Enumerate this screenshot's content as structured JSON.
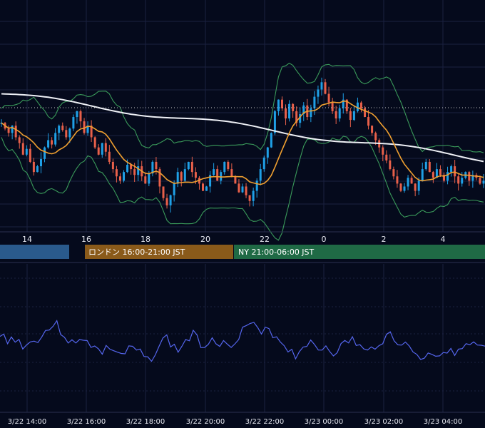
{
  "colors": {
    "background": "#050a1c",
    "grid": "#1a2140",
    "axis_text": "#e6e8f0",
    "candle_up": "#1fa0e6",
    "candle_down": "#e8604a",
    "ma_short": "#f0a030",
    "ma_long": "#eef0f5",
    "bollinger": "#3a9a5a",
    "oscillator": "#5566ee",
    "session_tokyo": "#2a5a8c",
    "session_london": "#8a5a1a",
    "session_ny": "#1f6a45",
    "current_price_line": "#c8c8c8"
  },
  "price_axis": {
    "x_ticks": [
      "14",
      "16",
      "18",
      "20",
      "22",
      "0",
      "2",
      "4"
    ]
  },
  "sessions": [
    {
      "id": "tokyo",
      "label": ""
    },
    {
      "id": "london",
      "label": "ロンドン 16:00-21:00 JST"
    },
    {
      "id": "ny",
      "label": "NY 21:00-06:00 JST"
    }
  ],
  "osc_axis": {
    "x_ticks": [
      "3/22 14:00",
      "3/22 16:00",
      "3/22 18:00",
      "3/22 20:00",
      "3/22 22:00",
      "3/23 00:00",
      "3/23 02:00",
      "3/23 04:00"
    ]
  },
  "chart_data": [
    {
      "type": "candlestick",
      "title": "",
      "x_start": "3/22 13:00",
      "x_end": "3/23 05:00",
      "overlays": [
        "moving-average-short",
        "moving-average-long",
        "bollinger-bands"
      ],
      "closes": [
        0.62,
        0.58,
        0.55,
        0.6,
        0.52,
        0.48,
        0.4,
        0.44,
        0.35,
        0.28,
        0.32,
        0.37,
        0.45,
        0.5,
        0.47,
        0.55,
        0.6,
        0.57,
        0.52,
        0.58,
        0.66,
        0.7,
        0.63,
        0.55,
        0.6,
        0.52,
        0.45,
        0.4,
        0.48,
        0.42,
        0.35,
        0.3,
        0.25,
        0.22,
        0.28,
        0.33,
        0.3,
        0.26,
        0.32,
        0.25,
        0.2,
        0.27,
        0.35,
        0.3,
        0.18,
        0.1,
        0.05,
        0.12,
        0.2,
        0.28,
        0.22,
        0.3,
        0.35,
        0.28,
        0.24,
        0.2,
        0.15,
        0.18,
        0.26,
        0.3,
        0.22,
        0.28,
        0.35,
        0.3,
        0.25,
        0.2,
        0.14,
        0.18,
        0.12,
        0.08,
        0.15,
        0.22,
        0.3,
        0.38,
        0.45,
        0.55,
        0.7,
        0.78,
        0.72,
        0.65,
        0.75,
        0.7,
        0.62,
        0.68,
        0.74,
        0.66,
        0.72,
        0.8,
        0.85,
        0.9,
        0.82,
        0.76,
        0.7,
        0.65,
        0.72,
        0.78,
        0.7,
        0.64,
        0.7,
        0.76,
        0.72,
        0.66,
        0.6,
        0.55,
        0.5,
        0.45,
        0.4,
        0.36,
        0.3,
        0.25,
        0.2,
        0.15,
        0.18,
        0.24,
        0.2,
        0.15,
        0.22,
        0.3,
        0.35,
        0.28,
        0.24,
        0.3,
        0.26,
        0.22,
        0.28,
        0.32,
        0.25,
        0.2,
        0.24,
        0.28,
        0.22,
        0.26,
        0.24,
        0.2,
        0.22
      ]
    },
    {
      "type": "line",
      "title": "",
      "series": [
        {
          "values": [
            0.5,
            0.52,
            0.48,
            0.5,
            0.46,
            0.44,
            0.4,
            0.38,
            0.42,
            0.45,
            0.5,
            0.55,
            0.6,
            0.65,
            0.72,
            0.7,
            0.62,
            0.55,
            0.48,
            0.42,
            0.38,
            0.45,
            0.52,
            0.48,
            0.4,
            0.35,
            0.3,
            0.28,
            0.32,
            0.36,
            0.3,
            0.28,
            0.22,
            0.26,
            0.3,
            0.35,
            0.28,
            0.25,
            0.2,
            0.15,
            0.2,
            0.3,
            0.38,
            0.45,
            0.5,
            0.42,
            0.35,
            0.3,
            0.38,
            0.45,
            0.5,
            0.55,
            0.48,
            0.42,
            0.38,
            0.45,
            0.52,
            0.48,
            0.44,
            0.4,
            0.36,
            0.42,
            0.48,
            0.55,
            0.62,
            0.7,
            0.74,
            0.68,
            0.62,
            0.55,
            0.6,
            0.64,
            0.58,
            0.52,
            0.46,
            0.4,
            0.34,
            0.28,
            0.22,
            0.3,
            0.38,
            0.44,
            0.4,
            0.36,
            0.3,
            0.34,
            0.38,
            0.32,
            0.28,
            0.32,
            0.36,
            0.4,
            0.44,
            0.48,
            0.42,
            0.36,
            0.3,
            0.26,
            0.32,
            0.38,
            0.44,
            0.48,
            0.52,
            0.56,
            0.5,
            0.46,
            0.42,
            0.38,
            0.34,
            0.3,
            0.24,
            0.2,
            0.18,
            0.22,
            0.28,
            0.24,
            0.26,
            0.3,
            0.28,
            0.34,
            0.3,
            0.36,
            0.4,
            0.34,
            0.38,
            0.42,
            0.36,
            0.32,
            0.34
          ]
        }
      ]
    }
  ]
}
